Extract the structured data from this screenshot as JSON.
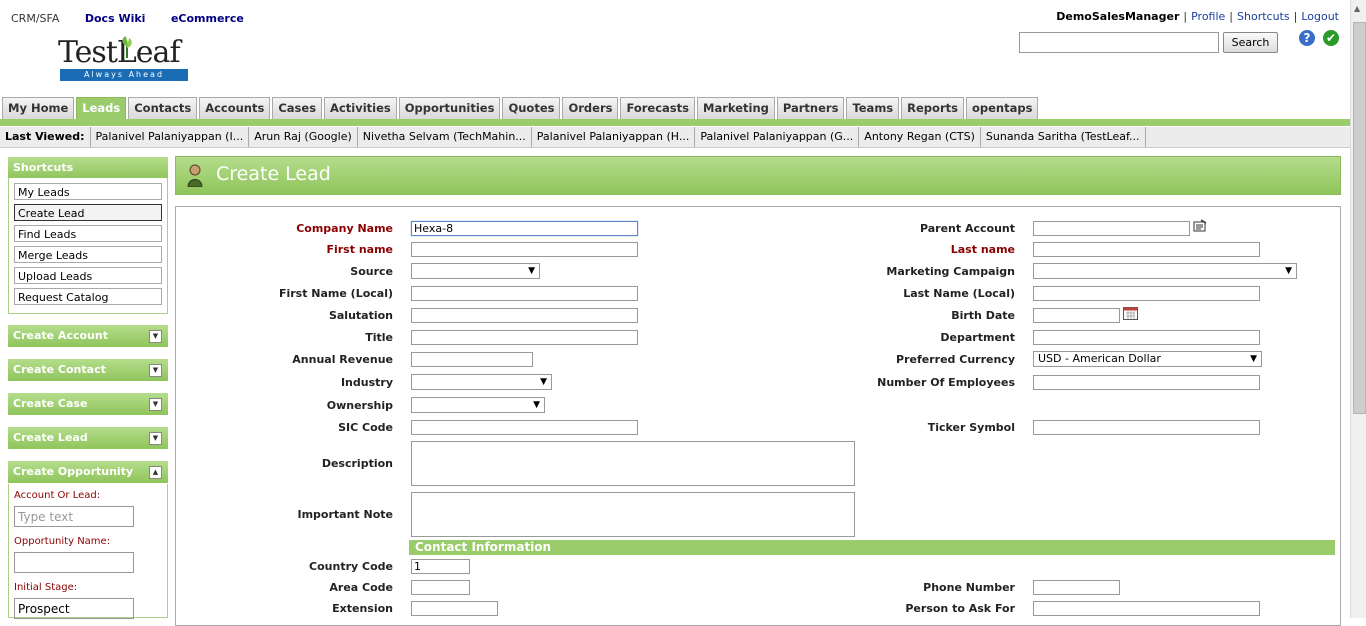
{
  "top_links": {
    "crm": "CRM/SFA",
    "docs": "Docs Wiki",
    "ecommerce": "eCommerce"
  },
  "user_bar": {
    "user": "DemoSalesManager",
    "profile": "Profile",
    "shortcuts": "Shortcuts",
    "logout": "Logout"
  },
  "logo": {
    "text": "TestLeaf",
    "tagline": "Always Ahead"
  },
  "search": {
    "value": "",
    "button": "Search"
  },
  "tabs": [
    "My Home",
    "Leads",
    "Contacts",
    "Accounts",
    "Cases",
    "Activities",
    "Opportunities",
    "Quotes",
    "Orders",
    "Forecasts",
    "Marketing",
    "Partners",
    "Teams",
    "Reports",
    "opentaps"
  ],
  "active_tab": "Leads",
  "last_viewed": {
    "label": "Last Viewed:",
    "items": [
      "Palanivel Palaniyappan (I...",
      "Arun Raj (Google)",
      "Nivetha Selvam (TechMahin...",
      "Palanivel Palaniyappan (H...",
      "Palanivel Palaniyappan (G...",
      "Antony Regan (CTS)",
      "Sunanda Saritha (TestLeaf..."
    ]
  },
  "sidebar": {
    "shortcuts_title": "Shortcuts",
    "shortcuts": [
      "My Leads",
      "Create Lead",
      "Find Leads",
      "Merge Leads",
      "Upload Leads",
      "Request Catalog"
    ],
    "active_shortcut": "Create Lead",
    "sections": [
      "Create Account",
      "Create Contact",
      "Create Case",
      "Create Lead"
    ],
    "opportunity": {
      "title": "Create Opportunity",
      "account_label": "Account Or Lead:",
      "account_placeholder": "Type text",
      "name_label": "Opportunity Name:",
      "stage_label": "Initial Stage:",
      "stage_value": "Prospect"
    }
  },
  "page": {
    "title": "Create Lead"
  },
  "form": {
    "company_name": {
      "label": "Company Name",
      "value": "Hexa-8"
    },
    "parent_account": {
      "label": "Parent Account",
      "value": ""
    },
    "first_name": {
      "label": "First name",
      "value": ""
    },
    "last_name": {
      "label": "Last name",
      "value": ""
    },
    "source": {
      "label": "Source",
      "value": ""
    },
    "marketing_campaign": {
      "label": "Marketing Campaign",
      "value": ""
    },
    "first_name_local": {
      "label": "First Name (Local)",
      "value": ""
    },
    "last_name_local": {
      "label": "Last Name (Local)",
      "value": ""
    },
    "salutation": {
      "label": "Salutation",
      "value": ""
    },
    "birth_date": {
      "label": "Birth Date",
      "value": ""
    },
    "title": {
      "label": "Title",
      "value": ""
    },
    "department": {
      "label": "Department",
      "value": ""
    },
    "annual_revenue": {
      "label": "Annual Revenue",
      "value": ""
    },
    "preferred_currency": {
      "label": "Preferred Currency",
      "value": "USD - American Dollar"
    },
    "industry": {
      "label": "Industry",
      "value": ""
    },
    "number_of_employees": {
      "label": "Number Of Employees",
      "value": ""
    },
    "ownership": {
      "label": "Ownership",
      "value": ""
    },
    "sic_code": {
      "label": "SIC Code",
      "value": ""
    },
    "ticker_symbol": {
      "label": "Ticker Symbol",
      "value": ""
    },
    "description": {
      "label": "Description",
      "value": ""
    },
    "important_note": {
      "label": "Important Note",
      "value": ""
    },
    "contact_section": "Contact Information",
    "country_code": {
      "label": "Country Code",
      "value": "1"
    },
    "area_code": {
      "label": "Area Code",
      "value": ""
    },
    "phone_number": {
      "label": "Phone Number",
      "value": ""
    },
    "extension": {
      "label": "Extension",
      "value": ""
    },
    "person_to_ask_for": {
      "label": "Person to Ask For",
      "value": ""
    }
  },
  "colors": {
    "green": "#9bcc6b",
    "required_label": "#8b0000",
    "link": "#000080"
  },
  "icons": [
    "help-icon",
    "check-icon",
    "person-icon",
    "lookup-icon",
    "calendar-icon",
    "chevron-down-icon",
    "chevron-up-icon"
  ]
}
